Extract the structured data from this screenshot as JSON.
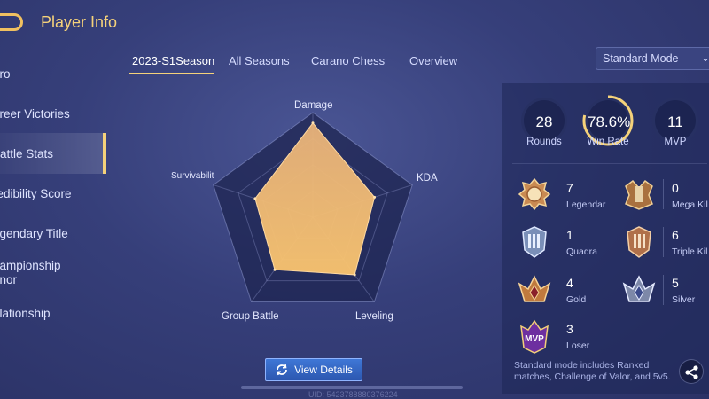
{
  "header": {
    "title": "Player Info"
  },
  "sidebar": {
    "items": [
      {
        "label": "ero"
      },
      {
        "label": "areer Victories"
      },
      {
        "label": "attle Stats"
      },
      {
        "label": "redibility Score"
      },
      {
        "label": "egendary Title"
      },
      {
        "label": "hampionship onor"
      },
      {
        "label": "elationship"
      }
    ]
  },
  "tabs": [
    {
      "label": "2023-S1Season"
    },
    {
      "label": "All Seasons"
    },
    {
      "label": "Carano Chess"
    },
    {
      "label": "Overview"
    }
  ],
  "mode_select": {
    "value": "Standard Mode"
  },
  "chart_data": {
    "type": "radar",
    "axes": [
      "Damage",
      "KDA",
      "Leveling",
      "Group Battle",
      "Survivabilit"
    ],
    "values": [
      0.9,
      0.62,
      0.68,
      0.62,
      0.58
    ],
    "max": 1,
    "fill_color": "#f7b766"
  },
  "view_details": {
    "label": "View Details"
  },
  "uid": {
    "text": "UID: 5423788880376224"
  },
  "summary": {
    "rounds": {
      "value": "28",
      "label": "Rounds"
    },
    "win_rate": {
      "value": "78.6%",
      "label": "Win Rate",
      "fraction": 0.786
    },
    "mvp": {
      "value": "11",
      "label": "MVP"
    }
  },
  "badges": [
    {
      "count": "7",
      "name": "Legendar"
    },
    {
      "count": "0",
      "name": "Mega Kil"
    },
    {
      "count": "1",
      "name": "Quadra"
    },
    {
      "count": "6",
      "name": "Triple Kil"
    },
    {
      "count": "4",
      "name": "Gold"
    },
    {
      "count": "5",
      "name": "Silver"
    },
    {
      "count": "3",
      "name": "Loser",
      "emblem_text": "MVP"
    }
  ],
  "note": {
    "text": "Standard mode includes Ranked matches, Challenge of Valor, and 5v5."
  },
  "colors": {
    "accent": "#f5d27a",
    "button": "#3f77d6"
  }
}
